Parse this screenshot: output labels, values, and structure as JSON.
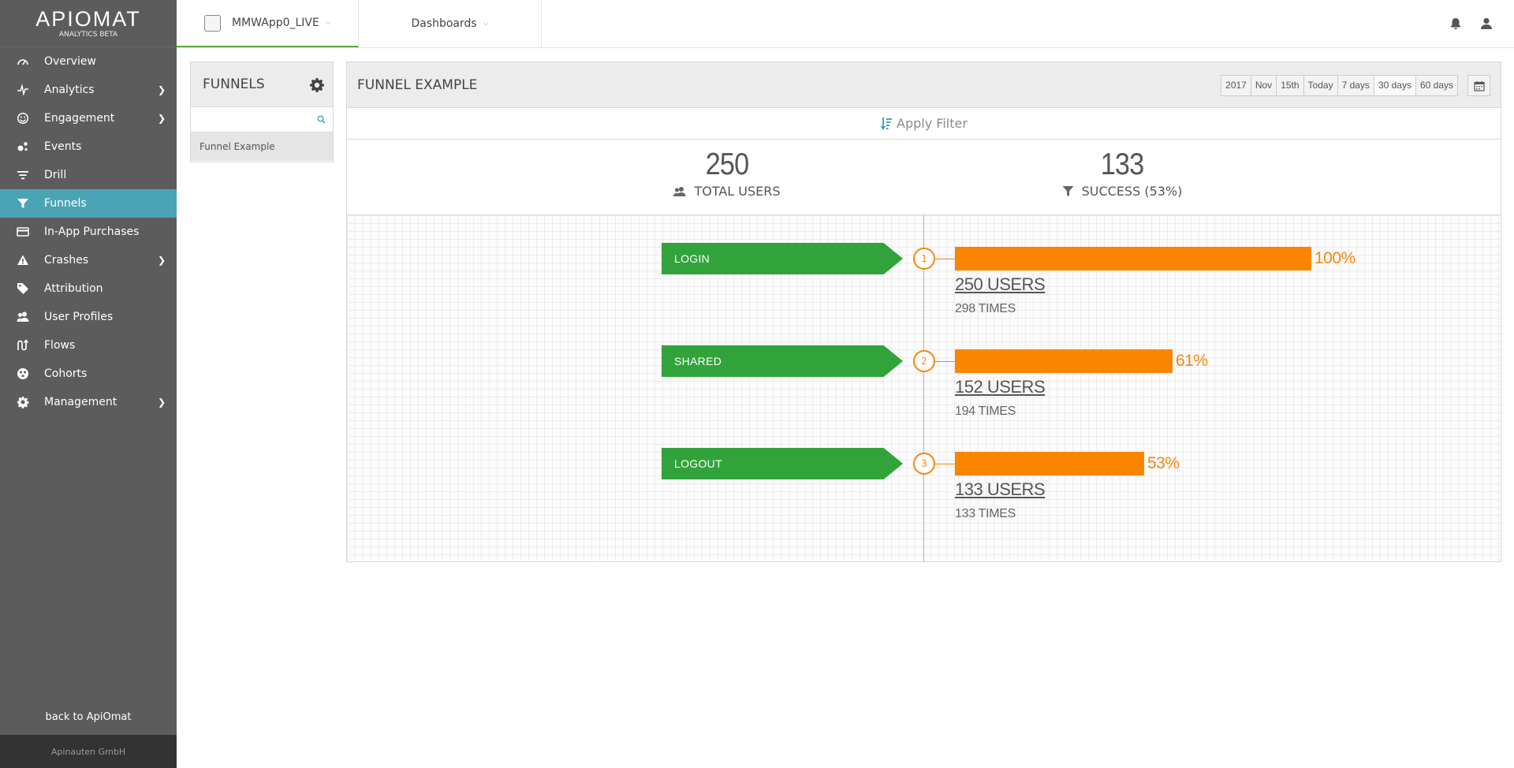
{
  "brand": {
    "logo_text": "APIOMAT",
    "subtitle": "ANALYTICS BETA"
  },
  "sidebar": {
    "items": [
      {
        "label": "Overview",
        "icon": "speedometer-icon",
        "chevron": false,
        "active": false
      },
      {
        "label": "Analytics",
        "icon": "pulse-icon",
        "chevron": true,
        "active": false
      },
      {
        "label": "Engagement",
        "icon": "smiley-icon",
        "chevron": true,
        "active": false
      },
      {
        "label": "Events",
        "icon": "events-icon",
        "chevron": false,
        "active": false
      },
      {
        "label": "Drill",
        "icon": "drill-icon",
        "chevron": false,
        "active": false
      },
      {
        "label": "Funnels",
        "icon": "funnel-icon",
        "chevron": false,
        "active": true
      },
      {
        "label": "In-App Purchases",
        "icon": "credit-card-icon",
        "chevron": false,
        "active": false
      },
      {
        "label": "Crashes",
        "icon": "warning-icon",
        "chevron": true,
        "active": false
      },
      {
        "label": "Attribution",
        "icon": "tag-icon",
        "chevron": false,
        "active": false
      },
      {
        "label": "User Profiles",
        "icon": "users-icon",
        "chevron": false,
        "active": false
      },
      {
        "label": "Flows",
        "icon": "flows-icon",
        "chevron": false,
        "active": false
      },
      {
        "label": "Cohorts",
        "icon": "cohorts-icon",
        "chevron": false,
        "active": false
      },
      {
        "label": "Management",
        "icon": "gear-icon",
        "chevron": true,
        "active": false
      }
    ],
    "back_link": "back to ApiOmat",
    "footer": "Apinauten GmbH"
  },
  "topbar": {
    "app_name": "MMWApp0_LIVE",
    "dashboards_label": "Dashboards"
  },
  "funnels_panel": {
    "title": "FUNNELS",
    "search_placeholder": "",
    "items": [
      "Funnel Example"
    ]
  },
  "main_panel": {
    "title": "FUNNEL EXAMPLE",
    "date_options": [
      "2017",
      "Nov",
      "15th",
      "Today",
      "7 days",
      "30 days",
      "60 days"
    ],
    "selected_date": "30 days",
    "apply_filter": "Apply Filter",
    "total_users_value": "250",
    "total_users_label": "TOTAL USERS",
    "success_value": "133",
    "success_label": "SUCCESS (53%)"
  },
  "funnel_steps": [
    {
      "index": "1",
      "name": "LOGIN",
      "percent": 100,
      "percent_label": "100%",
      "users_label": "250 USERS",
      "times_label": "298 TIMES"
    },
    {
      "index": "2",
      "name": "SHARED",
      "percent": 61,
      "percent_label": "61%",
      "users_label": "152 USERS",
      "times_label": "194 TIMES"
    },
    {
      "index": "3",
      "name": "LOGOUT",
      "percent": 53,
      "percent_label": "53%",
      "users_label": "133 USERS",
      "times_label": "133 TIMES"
    }
  ],
  "colors": {
    "sidebar_bg": "#5c5c5c",
    "active_item": "#4aa4b6",
    "step_green": "#32a33a",
    "bar_orange": "#fc8500"
  }
}
